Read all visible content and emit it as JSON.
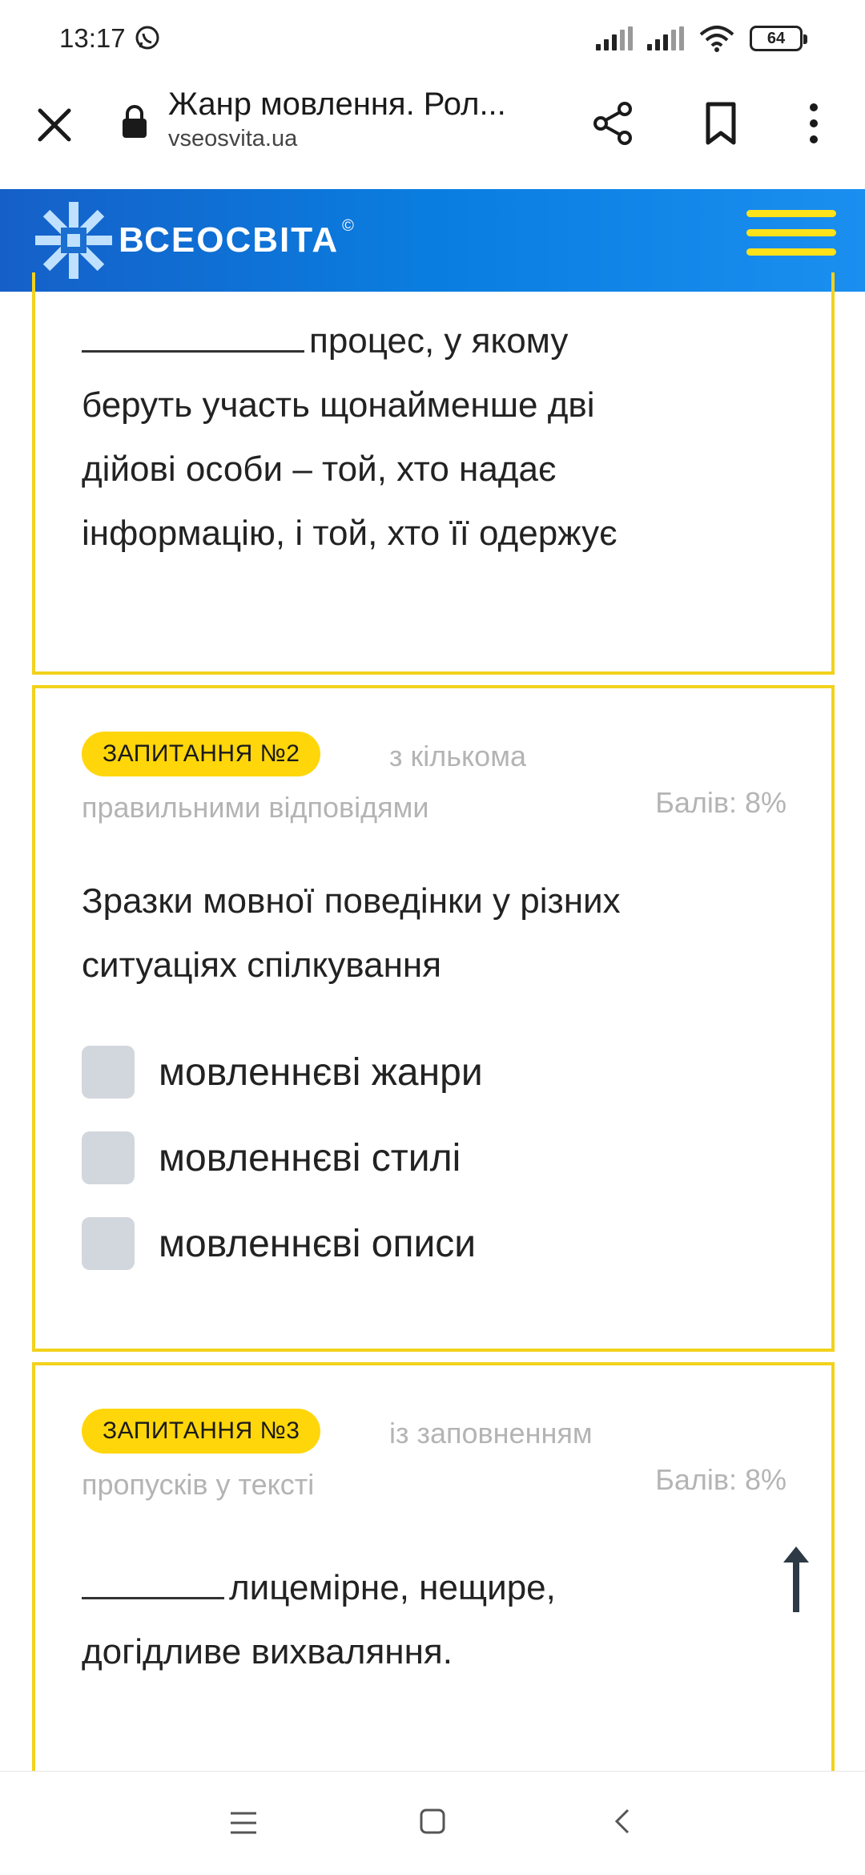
{
  "status_bar": {
    "time": "13:17",
    "battery": "64",
    "icons": [
      "viber-icon",
      "signal-icon",
      "signal-icon",
      "wifi-icon",
      "battery-icon"
    ]
  },
  "browser": {
    "page_title": "Жанр мовлення. Рол...",
    "url": "vseosvita.ua"
  },
  "site": {
    "logo_text": "ВСЕОСВІТА",
    "logo_mark": "©",
    "brand_color": "#0a7ee0",
    "accent_color": "#ffd60a"
  },
  "question1": {
    "text_lines": [
      "процес, у якому",
      "беруть участь щонайменше дві",
      "дійові особи – той, хто надає",
      "інформацію, і той, хто її одержує"
    ]
  },
  "question2": {
    "badge": "ЗАПИТАННЯ №2",
    "type_line1": "з кількома",
    "type_line2": "правильними відповідями",
    "points": "Балів: 8%",
    "text_lines": [
      "Зразки мовної поведінки у різних",
      "ситуаціях спілкування"
    ],
    "options": [
      {
        "label": "мовленнєві жанри",
        "checked": false
      },
      {
        "label": "мовленнєві стилі",
        "checked": false
      },
      {
        "label": "мовленнєві описи",
        "checked": false
      }
    ]
  },
  "question3": {
    "badge": "ЗАПИТАННЯ №3",
    "type_line1": "із заповненням",
    "type_line2": "пропусків у тексті",
    "points": "Балів: 8%",
    "text_lines": [
      "лицемірне, нещире,",
      "догідливе вихваляння."
    ]
  }
}
